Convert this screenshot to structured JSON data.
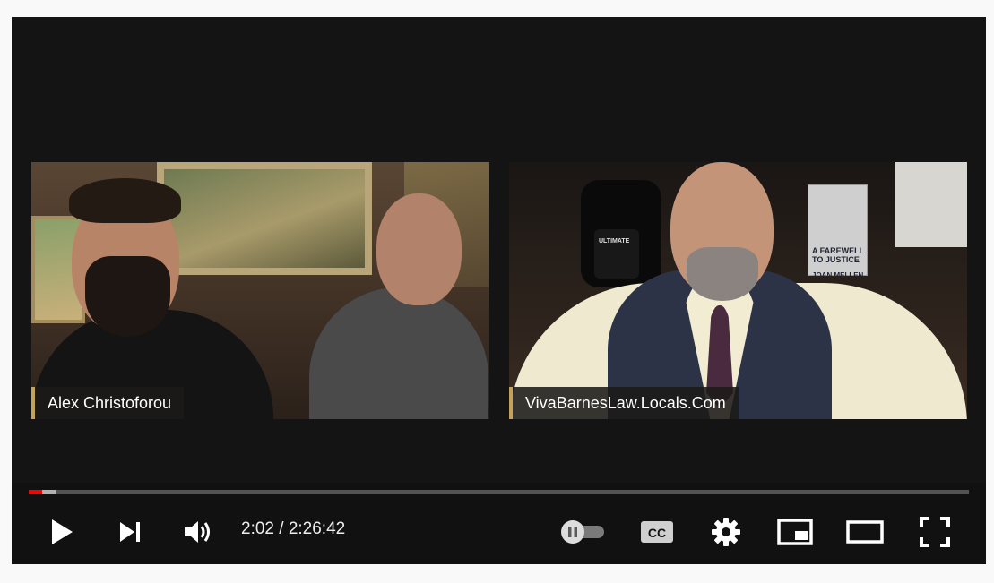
{
  "video": {
    "left_speaker_name": "Alex Christoforou",
    "right_speaker_name": "VivaBarnesLaw.Locals.Com",
    "book_title": "A FAREWELL TO JUSTICE",
    "book_author": "JOAN MELLEN",
    "mug_text": "ULTIMATE"
  },
  "playback": {
    "current_time": "2:02",
    "duration": "2:26:42",
    "time_display": "2:02 / 2:26:42",
    "progress_played": 0.014,
    "progress_buffered": 0.029
  },
  "controls": {
    "play_icon": "play-icon",
    "next_icon": "next-icon",
    "volume_icon": "volume-icon",
    "autoplay_icon": "autoplay-toggle-icon",
    "autoplay_state": "paused",
    "captions_label": "CC",
    "settings_icon": "gear-icon",
    "miniplayer_icon": "miniplayer-icon",
    "theater_icon": "theater-mode-icon",
    "fullscreen_icon": "fullscreen-icon"
  },
  "colors": {
    "progress_played": "#ff0000",
    "accent_bar": "#c5a25a",
    "player_bg": "#111112"
  }
}
